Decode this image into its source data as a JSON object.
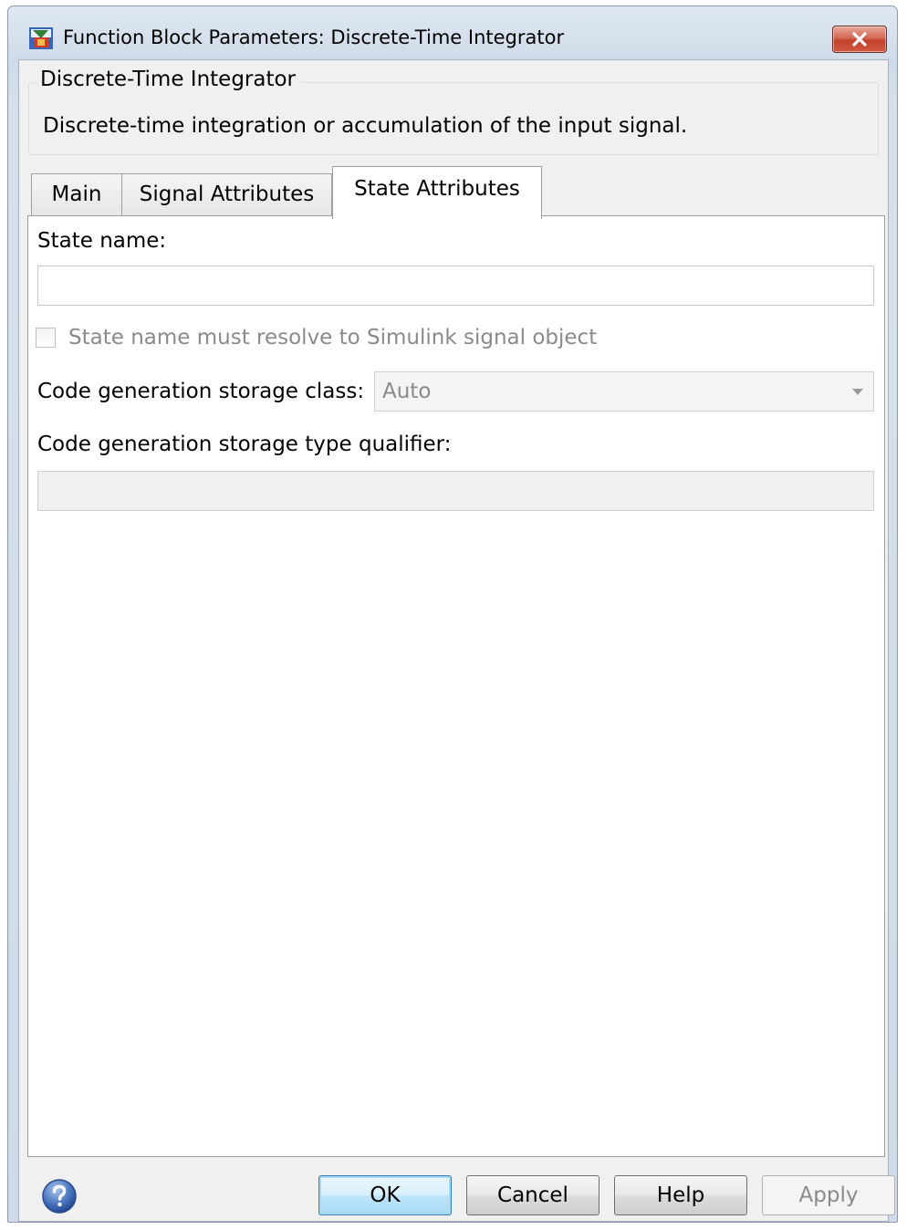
{
  "window": {
    "title": "Function Block Parameters: Discrete-Time Integrator"
  },
  "block": {
    "name": "Discrete-Time Integrator",
    "description": "Discrete-time integration or accumulation of the input signal."
  },
  "tabs": [
    {
      "label": "Main",
      "selected": false
    },
    {
      "label": "Signal Attributes",
      "selected": false
    },
    {
      "label": "State Attributes",
      "selected": true
    }
  ],
  "state_attributes": {
    "state_name_label": "State name:",
    "state_name_value": "",
    "resolve_checkbox_label": "State name must resolve to Simulink signal object",
    "resolve_checkbox_checked": false,
    "storage_class_label": "Code generation storage class:",
    "storage_class_value": "Auto",
    "type_qualifier_label": "Code generation storage type qualifier:",
    "type_qualifier_value": ""
  },
  "buttons": {
    "ok": "OK",
    "cancel": "Cancel",
    "help": "Help",
    "apply": "Apply"
  },
  "icons": {
    "app": "simulink-block-icon",
    "close": "close-icon",
    "help": "help-icon",
    "dropdown": "chevron-down-icon"
  },
  "colors": {
    "close_button": "#c3412b",
    "ok_button_border": "#3c7fb1",
    "disabled_text": "#8a8a8a"
  }
}
